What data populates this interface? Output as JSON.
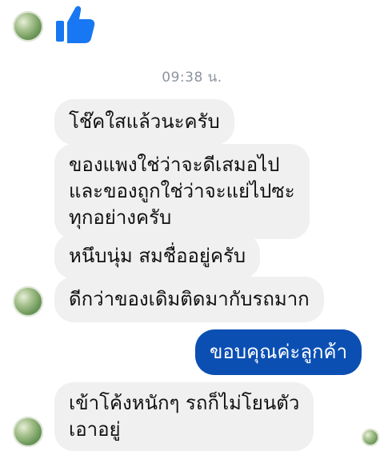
{
  "conversation": {
    "timestamp": "09:38 น.",
    "incoming": [
      {
        "lines": [
          "โช๊คใสแล้วนะครับ"
        ]
      },
      {
        "lines": [
          "ของแพงใช่ว่าจะดีเสมอไป",
          "และของถูกใช่ว่าจะแย่ไปซะ",
          "ทุกอย่างครับ"
        ]
      },
      {
        "lines": [
          "หนึบนุ่ม สมชื่ออยู่ครับ"
        ]
      },
      {
        "lines": [
          "ดีกว่าของเดิมติดมากับรถมาก"
        ]
      },
      {
        "lines": [
          "เข้าโค้งหนักๆ รถก็ไม่โยนตัว",
          "เอาอยู่"
        ]
      }
    ],
    "outgoing": [
      {
        "lines": [
          "ขอบคุณค่ะลูกค้า"
        ]
      }
    ]
  },
  "icons": {
    "like": "thumbs-up-icon",
    "like_color": "#1877f2",
    "outgoing_bubble_color": "#0b4fb3",
    "incoming_bubble_color": "#f1f0f0"
  }
}
